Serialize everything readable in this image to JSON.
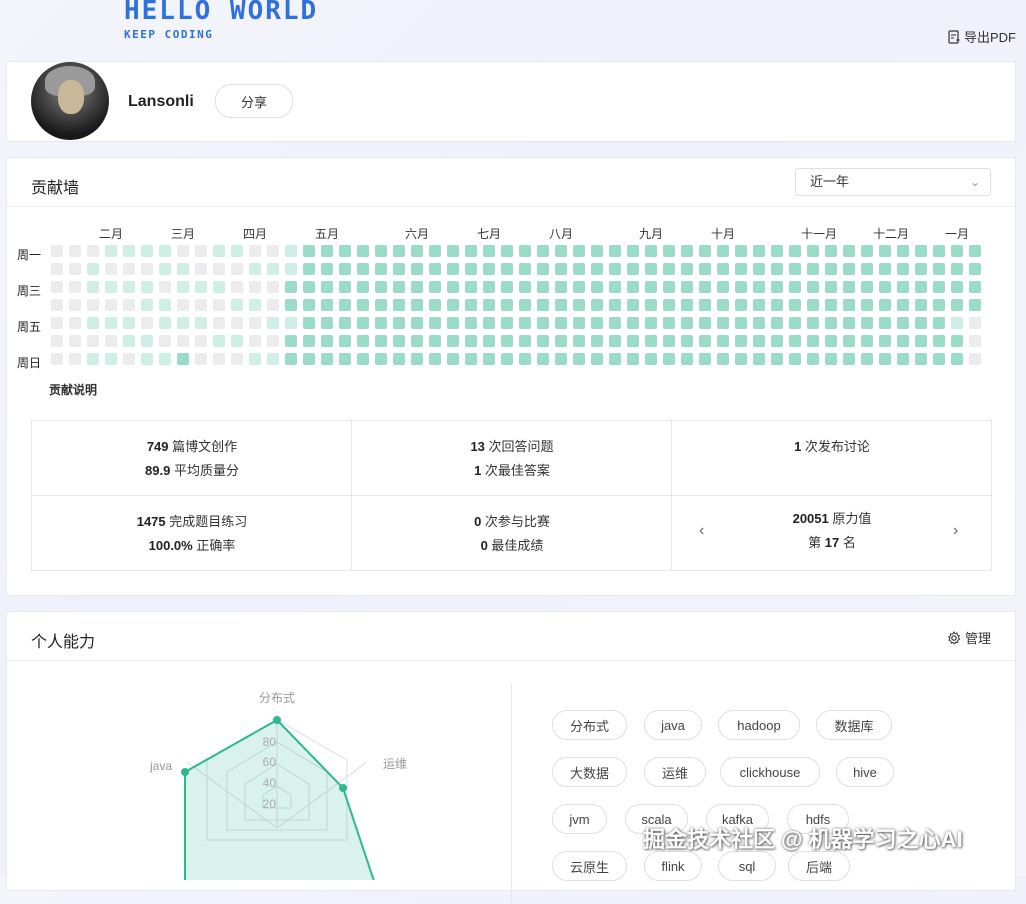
{
  "header": {
    "logo_title": "HELLO WORLD",
    "logo_subtitle": "KEEP CODING",
    "export_label": "导出PDF",
    "export_icon": "document-export-icon"
  },
  "profile": {
    "username": "Lansonli",
    "share_label": "分享"
  },
  "contribution": {
    "title": "贡献墙",
    "range_select": "近一年",
    "months": [
      "二月",
      "三月",
      "四月",
      "五月",
      "六月",
      "七月",
      "八月",
      "九月",
      "十月",
      "十一月",
      "十二月",
      "一月"
    ],
    "day_labels": [
      "周一",
      "周三",
      "周五",
      "周日"
    ],
    "legend_link": "贡献说明",
    "colors": {
      "active": "#9adcc7",
      "light": "#cfeee4",
      "empty": "#ececef"
    },
    "weeks": 52,
    "active_from_week": 14
  },
  "stats": [
    {
      "value": "749",
      "unit": "篇博文创作",
      "value2": "89.9",
      "unit2": "平均质量分"
    },
    {
      "value": "13",
      "unit": "次回答问题",
      "value2": "1",
      "unit2": "次最佳答案"
    },
    {
      "value": "1",
      "unit": "次发布讨论"
    },
    {
      "value": "1475",
      "unit": "完成题目练习",
      "value2": "100.0%",
      "unit2": "正确率"
    },
    {
      "value": "0",
      "unit": "次参与比赛",
      "value2": "0",
      "unit2": "最佳成绩"
    },
    {
      "value": "20051",
      "unit": "原力值",
      "prefix2": "第",
      "value2": "17",
      "unit2": "名"
    }
  ],
  "ability": {
    "title": "个人能力",
    "manage_label": "管理",
    "manage_icon": "gear-icon",
    "radar": {
      "axes": [
        "分布式",
        "运维",
        "java"
      ],
      "ticks": [
        "80",
        "60",
        "40",
        "20"
      ],
      "accent": "#2db894"
    },
    "tags": [
      "分布式",
      "java",
      "hadoop",
      "数据库",
      "大数据",
      "运维",
      "clickhouse",
      "hive",
      "jvm",
      "scala",
      "kafka",
      "hdfs",
      "云原生",
      "flink",
      "sql",
      "后端"
    ]
  },
  "watermark": "掘金技术社区 @ 机器学习之心AI"
}
